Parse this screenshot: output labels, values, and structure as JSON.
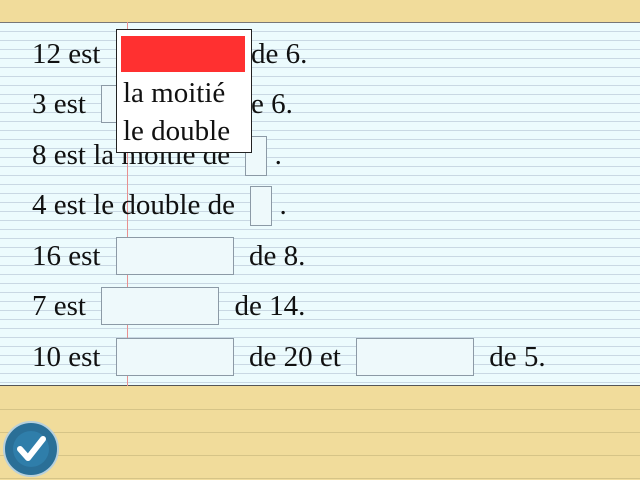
{
  "rows": [
    {
      "before": "12 est",
      "after": "de 6."
    },
    {
      "before": "3 est",
      "after": "e 6."
    },
    {
      "before": "8 est la moitié de",
      "after": "."
    },
    {
      "before": "4 est le double de",
      "after": "."
    },
    {
      "before": "16 est",
      "after": "de 8."
    },
    {
      "before": "7 est",
      "after": "de 14."
    },
    {
      "before": "10 est",
      "middle": "de 20 et",
      "after": "de 5."
    }
  ],
  "dropdown": {
    "options": [
      "la moitié",
      "le double"
    ],
    "selected_color": "#ff3030"
  },
  "submit_icon": "checkmark-icon",
  "colors": {
    "accent": "#2a6f97",
    "paper": "#ecfbfd",
    "band": "#f1dc9b"
  }
}
